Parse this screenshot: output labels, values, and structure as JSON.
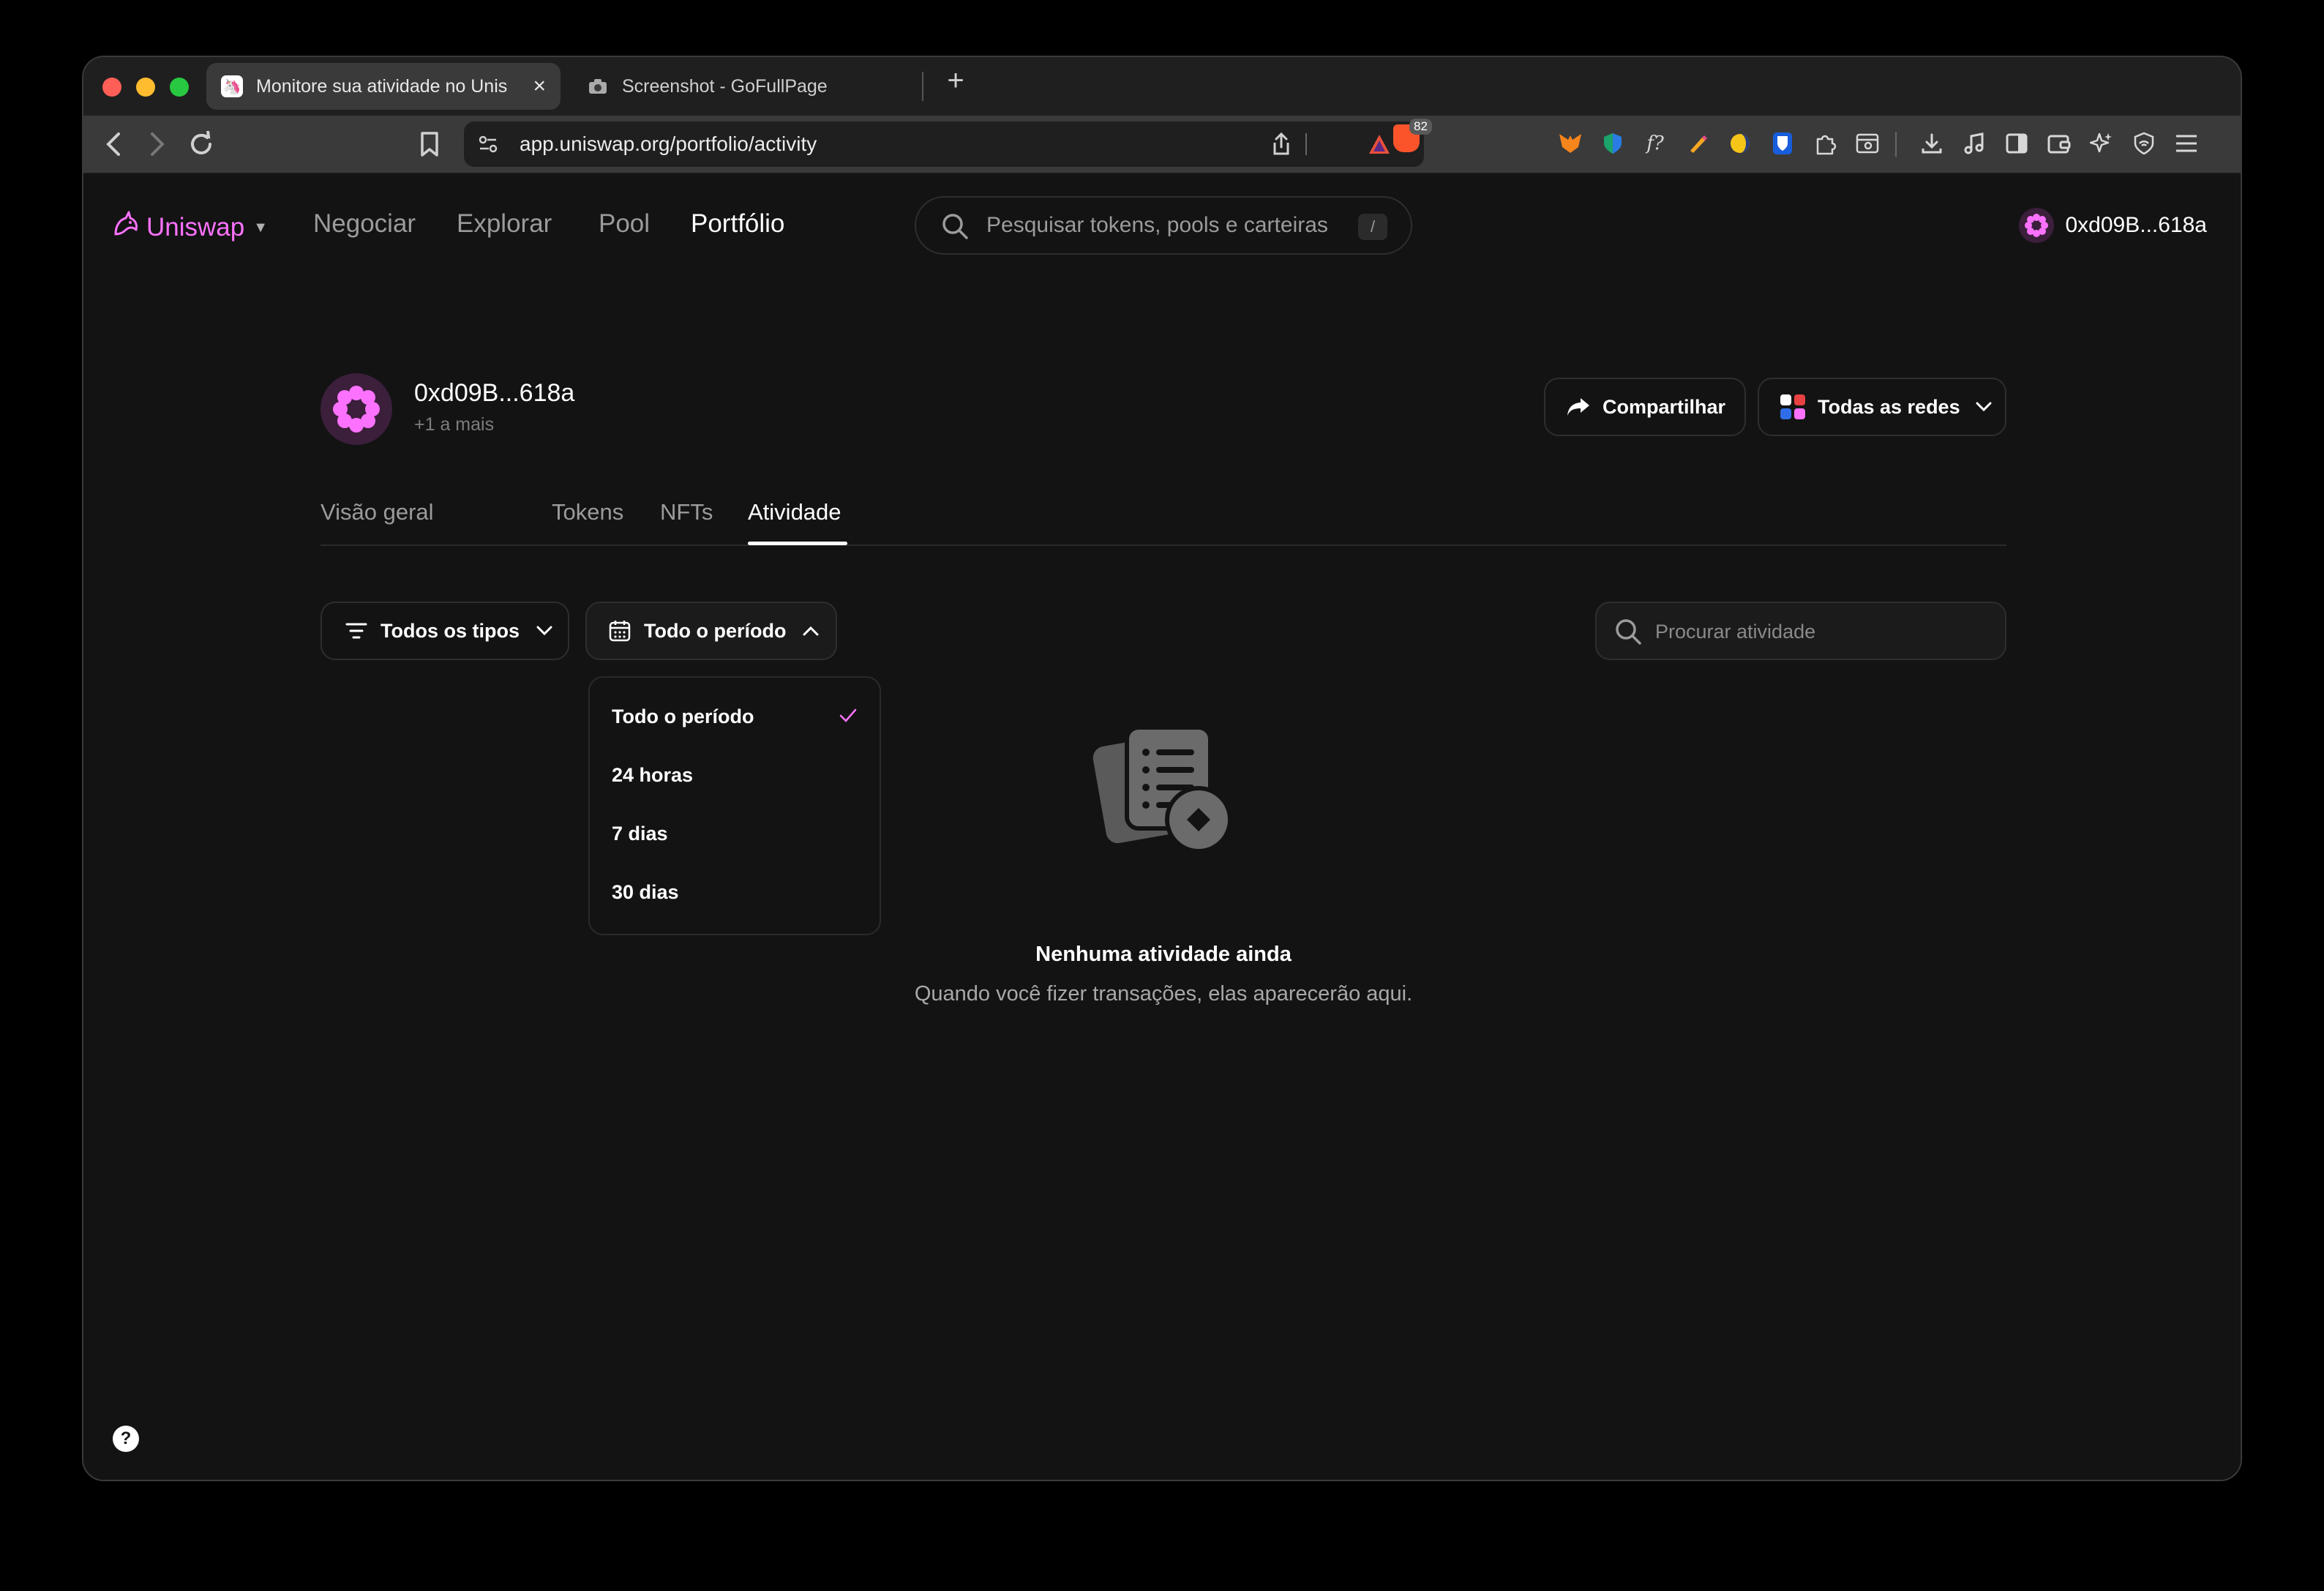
{
  "browser": {
    "tabs": [
      {
        "title": "Monitore sua atividade no Unis",
        "icon": "uniswap-favicon"
      },
      {
        "title": "Screenshot - GoFullPage",
        "icon": "camera-icon"
      }
    ],
    "url": "app.uniswap.org/portfolio/activity",
    "brave_badge": "82"
  },
  "header": {
    "logo": "Uniswap",
    "nav": [
      "Negociar",
      "Explorar",
      "Pool",
      "Portfólio"
    ],
    "search_placeholder": "Pesquisar tokens, pools e carteiras",
    "search_shortcut": "/",
    "account": "0xd09B...618a"
  },
  "profile": {
    "address": "0xd09B...618a",
    "more": "+1 a mais",
    "share_label": "Compartilhar",
    "networks_label": "Todas as redes"
  },
  "subtabs": [
    "Visão geral",
    "Tokens",
    "NFTs",
    "Atividade"
  ],
  "filters": {
    "types_label": "Todos os tipos",
    "period_label": "Todo o período",
    "search_placeholder": "Procurar atividade"
  },
  "period_dropdown": {
    "options": [
      "Todo o período",
      "24 horas",
      "7 dias",
      "30 dias"
    ],
    "selected": "Todo o período"
  },
  "empty_state": {
    "title": "Nenhuma atividade ainda",
    "subtitle": "Quando você fizer transações, elas aparecerão aqui."
  },
  "help": "?",
  "colors": {
    "accent": "#fc72ff",
    "background": "#131313",
    "border": "#2e2e2e"
  }
}
